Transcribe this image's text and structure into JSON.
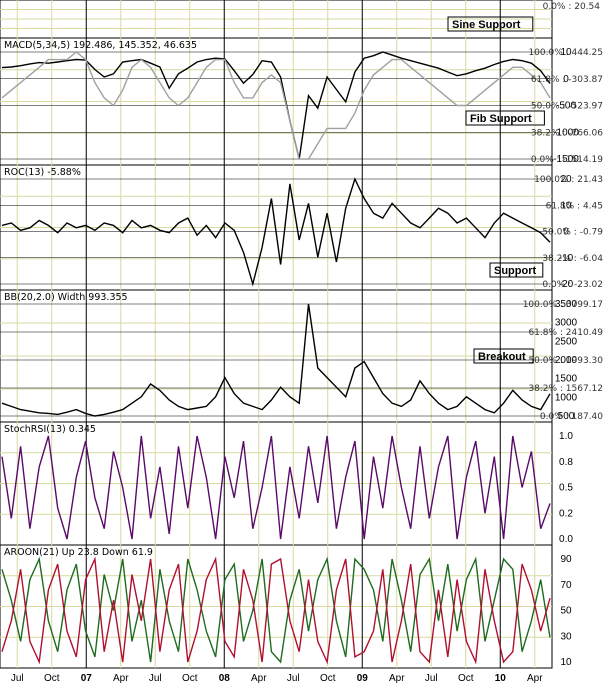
{
  "chart_data": {
    "type": "line",
    "x_months": [
      "Jul",
      "Oct",
      "07",
      "Apr",
      "Jul",
      "Oct",
      "08",
      "Apr",
      "Jul",
      "Oct",
      "09",
      "Apr",
      "Jul",
      "Oct",
      "10",
      "Apr"
    ],
    "top_strip": {
      "label": "0.0% : 20.54"
    },
    "panels": [
      {
        "id": "macd",
        "title": "MACD(5,34,5)  192.486, 145.352, 46.635",
        "y_ticks": [
          "10",
          "0",
          "-500",
          "-1000",
          "-1500"
        ],
        "fib_labels": [
          "100.0% : 444.25",
          "61.8% : -303.87",
          "50.0% : -523.97",
          "38.2% : -766.06",
          "0.0% : -1514.19"
        ],
        "notes": [
          "Sine Support",
          "Fib Support"
        ],
        "series": [
          {
            "name": "MACD",
            "color": "#000000",
            "values": [
              -50,
              -40,
              -20,
              10,
              30,
              20,
              40,
              60,
              80,
              70,
              -80,
              -200,
              -150,
              40,
              60,
              80,
              20,
              -40,
              -380,
              -150,
              -60,
              40,
              80,
              100,
              90,
              -100,
              -300,
              -160,
              60,
              40,
              -200,
              -900,
              -1514,
              -500,
              -700,
              -200,
              -400,
              -600,
              -120,
              100,
              140,
              200,
              150,
              100,
              60,
              20,
              -20,
              -60,
              -120,
              -180,
              -150,
              -100,
              -60,
              0,
              50,
              80,
              60,
              20,
              -100,
              -304
            ]
          },
          {
            "name": "Signal",
            "color": "#a0a0a0",
            "values": [
              -20,
              -10,
              0,
              10,
              20,
              30,
              30,
              30,
              40,
              30,
              0,
              -20,
              -30,
              -10,
              20,
              30,
              20,
              0,
              -20,
              -30,
              -20,
              0,
              20,
              30,
              30,
              0,
              -20,
              -20,
              0,
              10,
              0,
              -50,
              -100,
              -100,
              -80,
              -60,
              -60,
              -60,
              -40,
              -10,
              10,
              20,
              30,
              30,
              20,
              10,
              0,
              -10,
              -20,
              -30,
              -30,
              -20,
              -10,
              0,
              10,
              20,
              20,
              10,
              0,
              -20
            ]
          }
        ]
      },
      {
        "id": "roc",
        "title": "ROC(13) -5.88%",
        "y_ticks": [
          "20",
          "10",
          "0",
          "-10",
          "-20"
        ],
        "fib_labels": [
          "100.0% : 21.43",
          "61.8% : 4.45",
          "50.0% : -0.79",
          "38.2% : -6.04",
          "0.0% : -23.02"
        ],
        "notes": [
          "Support"
        ],
        "series": [
          {
            "name": "ROC",
            "color": "#000000",
            "values": [
              1,
              2,
              -1,
              0,
              3,
              1,
              -2,
              2,
              0,
              1,
              -1,
              2,
              1,
              -2,
              3,
              0,
              1,
              -1,
              -2,
              2,
              4,
              -3,
              1,
              -4,
              2,
              -1,
              -10,
              -23,
              -8,
              12,
              -15,
              18,
              -5,
              10,
              -12,
              6,
              -14,
              8,
              20,
              12,
              6,
              4,
              10,
              6,
              2,
              0,
              4,
              8,
              6,
              2,
              4,
              0,
              -4,
              2,
              6,
              4,
              2,
              0,
              -2,
              -5.88
            ]
          }
        ]
      },
      {
        "id": "bb",
        "title": "BB(20,2.0) Width 993.355",
        "y_ticks": [
          "3500",
          "3000",
          "2500",
          "2000",
          "1500",
          "1000",
          "500"
        ],
        "fib_labels": [
          "100.0% : 3799.17",
          "61.8% : 2410.49",
          "50.0% : 1993.30",
          "38.2% : 1567.12",
          "0.0% : 187.40"
        ],
        "notes": [
          "Breakout"
        ],
        "series": [
          {
            "name": "BB Width",
            "color": "#000000",
            "values": [
              700,
              600,
              500,
              450,
              400,
              380,
              350,
              420,
              500,
              380,
              300,
              350,
              420,
              500,
              700,
              900,
              1300,
              1100,
              800,
              600,
              500,
              550,
              600,
              900,
              1500,
              1000,
              700,
              600,
              500,
              800,
              1200,
              900,
              700,
              3799,
              1800,
              1500,
              1200,
              900,
              1800,
              2000,
              1500,
              1000,
              700,
              600,
              800,
              1400,
              1000,
              700,
              500,
              600,
              900,
              700,
              500,
              400,
              700,
              1100,
              800,
              600,
              500,
              993
            ]
          }
        ]
      },
      {
        "id": "stochrsi",
        "title": "StochRSI(13) 0.345",
        "y_ticks": [
          "1.0",
          "0.8",
          "0.5",
          "0.2",
          "0.0"
        ],
        "series": [
          {
            "name": "StochRSI",
            "color": "#5a0a6a",
            "values": [
              0.8,
              0.2,
              0.9,
              0.1,
              0.7,
              1,
              0.3,
              0,
              0.6,
              0.95,
              0.4,
              0.1,
              0.85,
              0.5,
              0,
              1,
              0.2,
              0.7,
              0.05,
              0.9,
              0.3,
              1,
              0.6,
              0,
              0.8,
              0.4,
              0.95,
              0.1,
              0.5,
              1,
              0,
              0.7,
              0.2,
              0.9,
              0.35,
              1,
              0.1,
              0.6,
              0.95,
              0,
              0.8,
              0.3,
              1,
              0.5,
              0.1,
              0.9,
              0.2,
              0.7,
              1,
              0,
              0.6,
              0.95,
              0.25,
              0.8,
              0,
              1,
              0.5,
              0.85,
              0.1,
              0.345
            ]
          }
        ]
      },
      {
        "id": "aroon",
        "title": "AROON(21) Up 23.8 Down 61.9",
        "y_ticks": [
          "90",
          "70",
          "50",
          "30",
          "10"
        ],
        "series": [
          {
            "name": "Up",
            "color": "#1f6b1f",
            "values": [
              90,
              60,
              20,
              80,
              100,
              40,
              10,
              70,
              95,
              30,
              5,
              85,
              50,
              100,
              20,
              60,
              0,
              90,
              40,
              10,
              100,
              70,
              30,
              5,
              80,
              95,
              20,
              50,
              100,
              10,
              0,
              60,
              90,
              30,
              80,
              100,
              40,
              5,
              100,
              90,
              70,
              20,
              100,
              60,
              10,
              85,
              100,
              40,
              95,
              30,
              80,
              100,
              20,
              60,
              100,
              90,
              10,
              40,
              80,
              23.8
            ]
          },
          {
            "name": "Down",
            "color": "#b01030",
            "values": [
              10,
              40,
              90,
              20,
              0,
              70,
              95,
              30,
              5,
              80,
              100,
              10,
              60,
              0,
              85,
              40,
              100,
              10,
              70,
              95,
              0,
              30,
              80,
              100,
              20,
              5,
              90,
              60,
              0,
              95,
              100,
              40,
              10,
              80,
              20,
              0,
              70,
              100,
              5,
              10,
              30,
              90,
              0,
              40,
              95,
              10,
              0,
              70,
              5,
              80,
              20,
              0,
              90,
              40,
              0,
              10,
              95,
              70,
              30,
              61.9
            ]
          }
        ]
      }
    ]
  }
}
